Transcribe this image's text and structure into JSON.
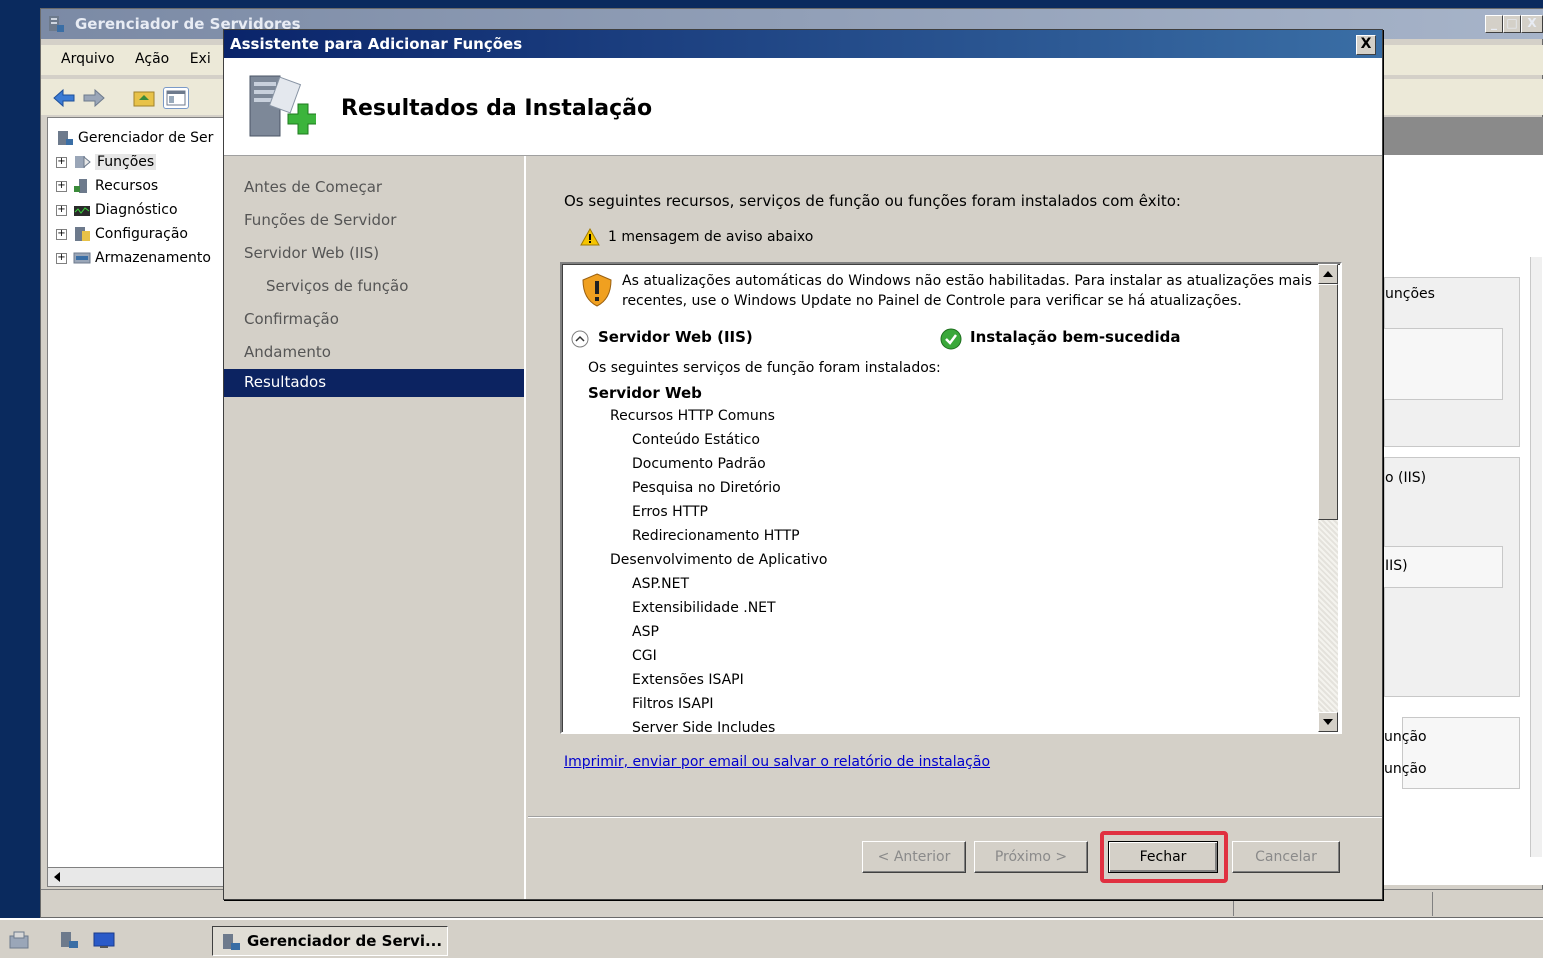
{
  "background_window": {
    "title": "Gerenciador de Servidores",
    "menu": [
      "Arquivo",
      "Ação",
      "Exi"
    ],
    "tree": [
      {
        "label": "Gerenciador de Ser",
        "expander": false
      },
      {
        "label": "Funções",
        "expander": true
      },
      {
        "label": "Recursos",
        "expander": true
      },
      {
        "label": "Diagnóstico",
        "expander": true
      },
      {
        "label": "Configuração",
        "expander": true
      },
      {
        "label": "Armazenamento",
        "expander": true
      }
    ],
    "right_links": [
      "unções",
      "o (IIS)",
      "IIS)",
      "unção",
      "unção"
    ],
    "controls": {
      "minimize": "_",
      "maximize": "□",
      "close": "X"
    }
  },
  "dialog": {
    "title": "Assistente para Adicionar Funções",
    "close": "X",
    "heading": "Resultados da Instalação",
    "nav": [
      "Antes de Começar",
      "Funções de Servidor",
      "Servidor Web (IIS)",
      "Serviços de função",
      "Confirmação",
      "Andamento",
      "Resultados"
    ],
    "intro": "Os seguintes recursos, serviços de função ou funções foram instalados com êxito:",
    "warning_summary": "1 mensagem de aviso abaixo",
    "warning_message_1": "As atualizações automáticas do Windows não estão habilitadas. Para instalar as atualizações mais",
    "warning_message_2": "recentes, use o Windows Update no Painel de Controle para verificar se há atualizações.",
    "role_name": "Servidor Web (IIS)",
    "role_status": "Instalação bem-sucedida",
    "installed_intro": "Os seguintes serviços de função foram instalados:",
    "section_title": "Servidor Web",
    "group1": "Recursos HTTP Comuns",
    "group1_items": [
      "Conteúdo Estático",
      "Documento Padrão",
      "Pesquisa no Diretório",
      "Erros HTTP",
      "Redirecionamento HTTP"
    ],
    "group2": "Desenvolvimento de Aplicativo",
    "group2_items": [
      "ASP.NET",
      "Extensibilidade .NET",
      "ASP",
      "CGI",
      "Extensões ISAPI",
      "Filtros ISAPI",
      "Server Side Includes"
    ],
    "print_link": "Imprimir, enviar por email ou salvar o relatório de instalação",
    "buttons": {
      "previous": "< Anterior",
      "next": "Próximo >",
      "close": "Fechar",
      "cancel": "Cancelar"
    },
    "highlight_color": "#e03040"
  },
  "taskbar": {
    "task": "Gerenciador de Servi..."
  }
}
